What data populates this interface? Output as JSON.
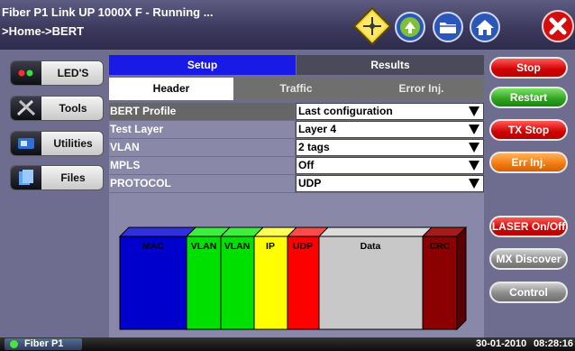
{
  "header": {
    "title": "Fiber P1 Link UP 1000X F  - Running ...",
    "breadcrumb": ">Home->BERT",
    "icons": [
      "signal-diamond-icon",
      "sync-icon",
      "folder-icon",
      "home-icon",
      "close-icon"
    ]
  },
  "nav": {
    "items": [
      {
        "label": "LED'S",
        "icon": "led-icon"
      },
      {
        "label": "Tools",
        "icon": "tools-icon"
      },
      {
        "label": "Utilities",
        "icon": "utilities-icon"
      },
      {
        "label": "Files",
        "icon": "files-icon"
      }
    ]
  },
  "tabs": {
    "top": [
      {
        "label": "Setup",
        "active": true
      },
      {
        "label": "Results",
        "active": false
      }
    ],
    "sub": [
      {
        "label": "Header",
        "active": true
      },
      {
        "label": "Traffic",
        "active": false
      },
      {
        "label": "Error Inj.",
        "active": false
      }
    ]
  },
  "settings": [
    {
      "label": "BERT Profile",
      "value": "Last configuration"
    },
    {
      "label": "Test Layer",
      "value": "Layer 4"
    },
    {
      "label": "VLAN",
      "value": "2 tags"
    },
    {
      "label": "MPLS",
      "value": "Off"
    },
    {
      "label": "PROTOCOL",
      "value": "UDP"
    }
  ],
  "frame": {
    "segments": [
      {
        "label": "MAC",
        "color": "#0000cc"
      },
      {
        "label": "VLAN",
        "color": "#00e000"
      },
      {
        "label": "VLAN",
        "color": "#00e000"
      },
      {
        "label": "IP",
        "color": "#ffff00"
      },
      {
        "label": "UDP",
        "color": "#ff0000"
      },
      {
        "label": "Data",
        "color": "#c8c8c8"
      },
      {
        "label": "CRC",
        "color": "#8b0000"
      }
    ]
  },
  "actions": [
    {
      "label": "Stop",
      "style": "red"
    },
    {
      "label": "Restart",
      "style": "green"
    },
    {
      "label": "TX Stop",
      "style": "red"
    },
    {
      "label": "Err Inj.",
      "style": "orange"
    },
    {
      "label": "LASER On/Off",
      "style": "red"
    },
    {
      "label": "MX Discover",
      "style": "grey"
    },
    {
      "label": "Control",
      "style": "grey"
    }
  ],
  "footer": {
    "port": "Fiber P1",
    "date": "30-01-2010",
    "time": "08:28:16"
  },
  "colors": {
    "background": "#6f6d8f",
    "tab_active": "#1a1ae6",
    "tab_inactive": "#4a4a5a",
    "subtab_active": "#ffffff",
    "subtab_inactive": "#6f6f6f",
    "label_row_dark": "#666666",
    "label_row_light": "#8a88a8"
  }
}
